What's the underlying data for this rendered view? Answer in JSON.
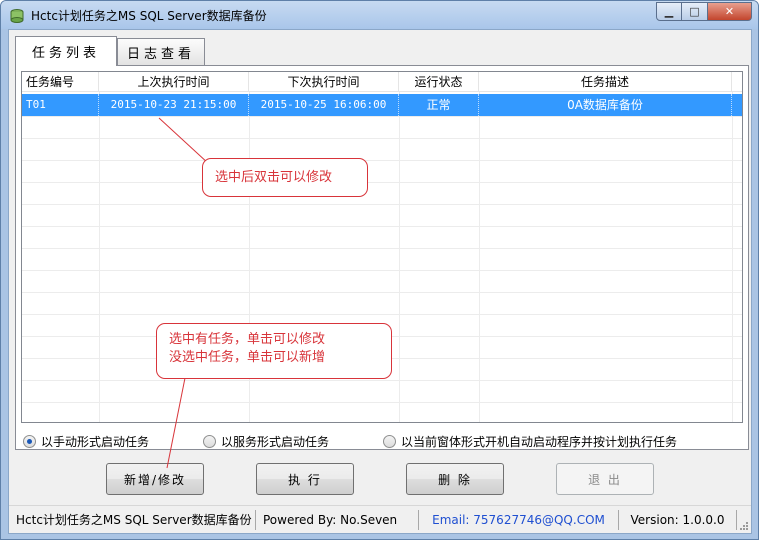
{
  "window": {
    "title": "Hctc计划任务之MS SQL Server数据库备份",
    "controls": {
      "minimize": "▁",
      "maximize": "□",
      "close": "✕"
    }
  },
  "tabs": [
    {
      "label": "任务列表",
      "active": true
    },
    {
      "label": "日志查看",
      "active": false
    }
  ],
  "task_list": {
    "columns": [
      "任务编号",
      "上次执行时间",
      "下次执行时间",
      "运行状态",
      "任务描述"
    ],
    "rows": [
      {
        "id": "T01",
        "last_run": "2015-10-23 21:15:00",
        "next_run": "2015-10-25 16:06:00",
        "status": "正常",
        "description": "0A数据库备份",
        "selected": true
      }
    ]
  },
  "annotations": {
    "top": "选中后双击可以修改",
    "bottom_line1": "选中有任务，单击可以修改",
    "bottom_line2": "没选中任务，单击可以新增"
  },
  "run_modes": [
    {
      "label": "以手动形式启动任务",
      "checked": true
    },
    {
      "label": "以服务形式启动任务",
      "checked": false
    },
    {
      "label": "以当前窗体形式开机自动启动程序并按计划执行任务",
      "checked": false
    }
  ],
  "buttons": {
    "add_edit": "新增/修改",
    "execute": "执 行",
    "delete": "删 除",
    "exit": "退 出"
  },
  "statusbar": {
    "app": "Hctc计划任务之MS SQL Server数据库备份",
    "powered_by": "Powered By: No.Seven",
    "email": "Email: 757627746@QQ.COM",
    "version": "Version: 1.0.0.0"
  },
  "colors": {
    "selection": "#3399ff",
    "annotation": "#d8343a",
    "email": "#1f4fd1"
  }
}
